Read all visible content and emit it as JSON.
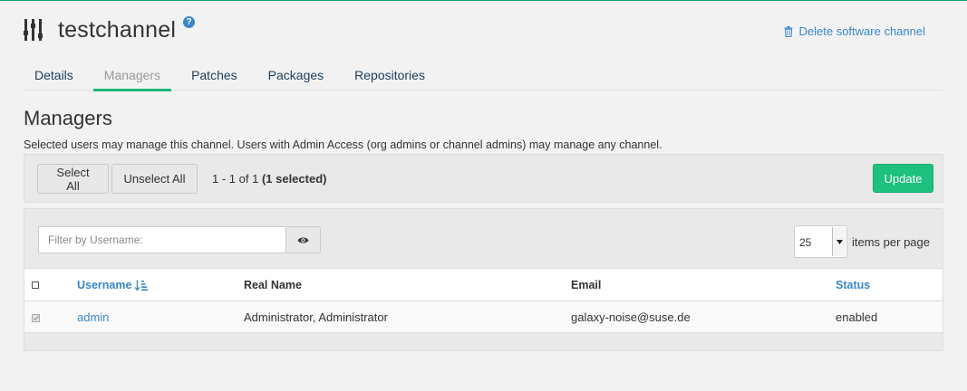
{
  "header": {
    "title": "testchannel",
    "help_glyph": "?",
    "delete_label": "Delete software channel"
  },
  "tabs": [
    {
      "label": "Details",
      "active": false
    },
    {
      "label": "Managers",
      "active": true
    },
    {
      "label": "Patches",
      "active": false
    },
    {
      "label": "Packages",
      "active": false
    },
    {
      "label": "Repositories",
      "active": false
    }
  ],
  "section": {
    "title": "Managers",
    "description": "Selected users may manage this channel. Users with Admin Access (org admins or channel admins) may manage any channel."
  },
  "toolbar": {
    "select_all": "Select All",
    "unselect_all": "Unselect All",
    "range": "1 - 1 of 1",
    "selected": "(1 selected)",
    "update": "Update"
  },
  "filter": {
    "placeholder": "Filter by Username:"
  },
  "per_page": {
    "value": "25",
    "label": "items per page"
  },
  "table": {
    "columns": {
      "username": "Username",
      "real_name": "Real Name",
      "email": "Email",
      "status": "Status"
    },
    "rows": [
      {
        "username": "admin",
        "real_name": "Administrator, Administrator",
        "email": "galaxy-noise@suse.de",
        "status": "enabled"
      }
    ]
  },
  "colors": {
    "accent_green": "#1fc17e",
    "link_blue": "#3a87c9",
    "tab_underline": "#1fb67a"
  }
}
